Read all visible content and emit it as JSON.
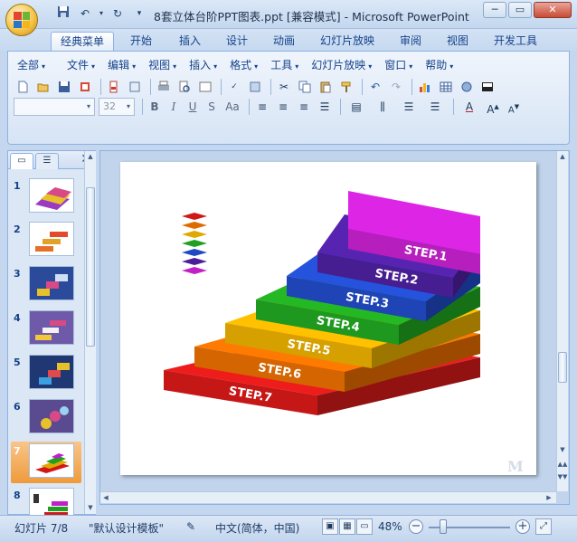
{
  "window": {
    "title": "8套立体台阶PPT图表.ppt [兼容模式] - Microsoft PowerPoint"
  },
  "ribbon_tabs": [
    "经典菜单",
    "开始",
    "插入",
    "设计",
    "动画",
    "幻灯片放映",
    "审阅",
    "视图",
    "开发工具"
  ],
  "classic_menu": [
    "全部",
    "文件",
    "编辑",
    "视图",
    "插入",
    "格式",
    "工具",
    "幻灯片放映",
    "窗口",
    "帮助"
  ],
  "format_bar": {
    "font_name": "",
    "font_size": "32",
    "bold": "B",
    "italic": "I",
    "underline": "U",
    "shadow": "S",
    "case": "Aa"
  },
  "slide_thumbnails": [
    {
      "num": "1"
    },
    {
      "num": "2"
    },
    {
      "num": "3"
    },
    {
      "num": "4"
    },
    {
      "num": "5"
    },
    {
      "num": "6"
    },
    {
      "num": "7"
    },
    {
      "num": "8"
    }
  ],
  "selected_slide": "7",
  "slide": {
    "steps": [
      "STEP.1",
      "STEP.2",
      "STEP.3",
      "STEP.4",
      "STEP.5",
      "STEP.6",
      "STEP.7"
    ],
    "step_colors": [
      "#c020c8",
      "#4b1f9a",
      "#2048c0",
      "#20a020",
      "#e0a800",
      "#e06a00",
      "#d01818"
    ],
    "watermark": "M"
  },
  "status": {
    "slide_counter": "幻灯片 7/8",
    "theme": "\"默认设计模板\"",
    "language": "中文(简体，中国)",
    "zoom": "48%"
  }
}
